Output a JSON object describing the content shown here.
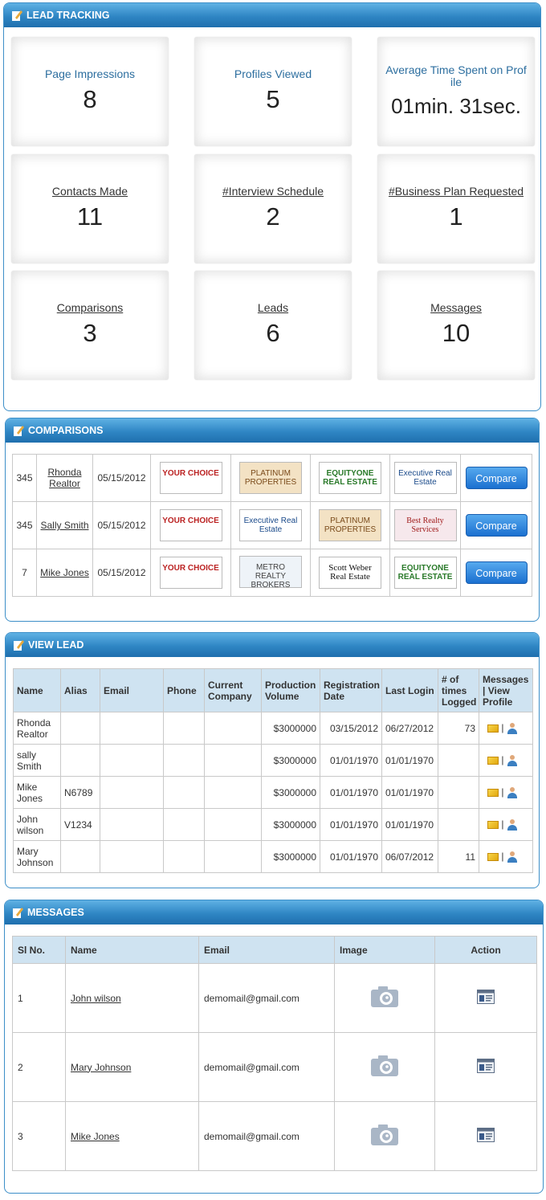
{
  "lead_tracking": {
    "title": "LEAD TRACKING",
    "tiles": [
      {
        "label": "Page Impressions",
        "value": "8"
      },
      {
        "label": "Profiles Viewed",
        "value": "5"
      },
      {
        "label": "Average Time Spent on Prof ile",
        "value": "01min. 31sec."
      },
      {
        "label": "Contacts Made",
        "value": "11"
      },
      {
        "label": "#Interview Schedule",
        "value": "2"
      },
      {
        "label": "#Business Plan Requested",
        "value": "1"
      },
      {
        "label": "Comparisons",
        "value": "3"
      },
      {
        "label": "Leads",
        "value": "6"
      },
      {
        "label": "Messages",
        "value": "10"
      }
    ]
  },
  "comparisons": {
    "title": "COMPARISONS",
    "button_label": "Compare",
    "rows": [
      {
        "id": "345",
        "name": "Rhonda Realtor",
        "date": "05/15/2012",
        "logos": [
          "YOUR CHOICE",
          "PLATINUM PROPERTIES",
          "EQUITYONE REAL ESTATE",
          "Executive Real Estate"
        ]
      },
      {
        "id": "345",
        "name": "Sally Smith",
        "date": "05/15/2012",
        "logos": [
          "YOUR CHOICE",
          "Executive Real Estate",
          "PLATINUM PROPERTIES",
          "Best Realty Services"
        ]
      },
      {
        "id": "7",
        "name": "Mike Jones",
        "date": "05/15/2012",
        "logos": [
          "YOUR CHOICE",
          "METRO REALTY BROKERS",
          "Scott Weber Real Estate",
          "EQUITYONE REAL ESTATE"
        ]
      }
    ]
  },
  "view_lead": {
    "title": "VIEW LEAD",
    "columns": [
      "Name",
      "Alias",
      "Email",
      "Phone",
      "Current Company",
      "Production Volume",
      "Registration Date",
      "Last Login",
      "# of times Logged",
      "Messages | View Profile"
    ],
    "rows": [
      {
        "name": "Rhonda Realtor",
        "alias": "",
        "email": "",
        "phone": "",
        "company": "",
        "volume": "$3000000",
        "reg": "03/15/2012",
        "last": "06/27/2012",
        "logged": "73"
      },
      {
        "name": "sally Smith",
        "alias": "",
        "email": "",
        "phone": "",
        "company": "",
        "volume": "$3000000",
        "reg": "01/01/1970",
        "last": "01/01/1970",
        "logged": ""
      },
      {
        "name": "Mike Jones",
        "alias": "N6789",
        "email": "",
        "phone": "",
        "company": "",
        "volume": "$3000000",
        "reg": "01/01/1970",
        "last": "01/01/1970",
        "logged": ""
      },
      {
        "name": "John wilson",
        "alias": "V1234",
        "email": "",
        "phone": "",
        "company": "",
        "volume": "$3000000",
        "reg": "01/01/1970",
        "last": "01/01/1970",
        "logged": ""
      },
      {
        "name": "Mary Johnson",
        "alias": "",
        "email": "",
        "phone": "",
        "company": "",
        "volume": "$3000000",
        "reg": "01/01/1970",
        "last": "06/07/2012",
        "logged": "11"
      }
    ],
    "separator": "|"
  },
  "messages": {
    "title": "MESSAGES",
    "columns": [
      "Sl No.",
      "Name",
      "Email",
      "Image",
      "Action"
    ],
    "rows": [
      {
        "no": "1",
        "name": "John wilson",
        "email": "demomail@gmail.com"
      },
      {
        "no": "2",
        "name": "Mary Johnson",
        "email": "demomail@gmail.com"
      },
      {
        "no": "3",
        "name": "Mike Jones",
        "email": "demomail@gmail.com"
      }
    ]
  }
}
